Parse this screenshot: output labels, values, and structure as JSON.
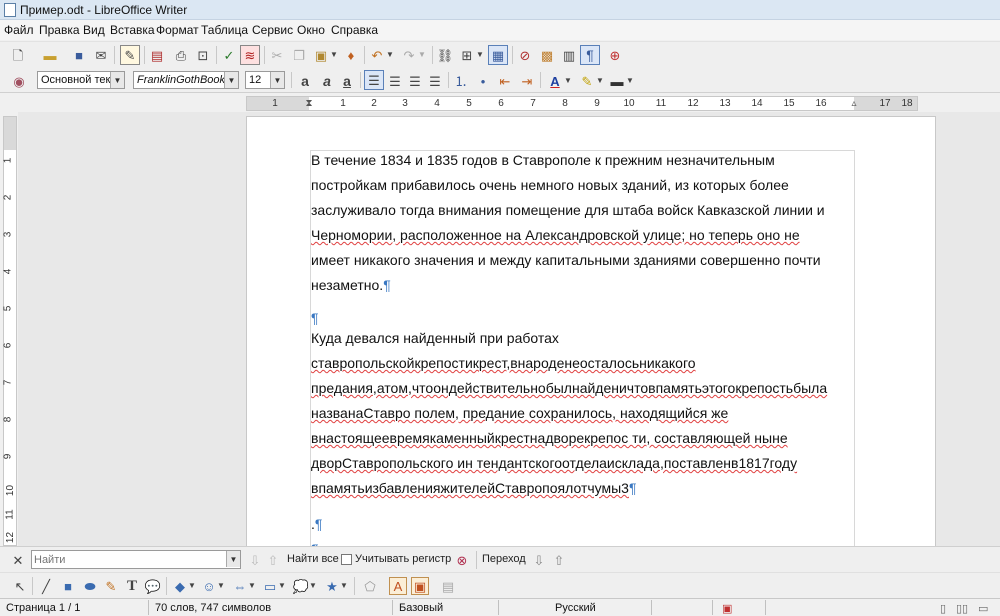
{
  "window": {
    "title": "Пример.odt - LibreOffice Writer"
  },
  "menu": [
    "Файл",
    "Правка",
    "Вид",
    "Вставка",
    "Формат",
    "Таблица",
    "Сервис",
    "Окно",
    "Справка"
  ],
  "formatting": {
    "paragraph_style": "Основной текс",
    "font_name": "FranklinGothBookTT",
    "font_size": "12"
  },
  "ruler": {
    "labels": [
      "1",
      "1",
      "2",
      "3",
      "4",
      "5",
      "6",
      "7",
      "8",
      "9",
      "10",
      "11",
      "12",
      "13",
      "14",
      "15",
      "16",
      "17",
      "18"
    ]
  },
  "vruler": {
    "labels": [
      "1",
      "2",
      "3",
      "4",
      "5",
      "6",
      "7",
      "8",
      "9",
      "10",
      "11",
      "12"
    ]
  },
  "document": {
    "para1_lines": [
      "В течение 1834 и 1835 годов в Ставрополе к прежним незначительным",
      "постройкам прибавилось очень немного новых зданий, из которых более",
      "заслуживало тогда внимания помещение для штаба войск Кавказской линии и",
      "Черномории, расположенное на Александровской улице; но теперь оно не",
      "имеет никакого значения и между капитальными зданиями совершенно почти",
      "незаметно."
    ],
    "pilcrow": "¶",
    "para2_lines": [
      "Куда девался найденный при работах",
      "ставропольскойкрепостикрест,внароденеосталосьникакого",
      "предания,атом,чтоондействительнобылнайденичтовпамятьэтогокрепостьбыла",
      "названаСтавро полем, предание сохранилось, находящийся же",
      "внастоящеевремякаменныйкрестнадворекрепос ти, составляющей ныне",
      "дворСтавропольского ин тендантскогоотделаисклада,поставленв1817году",
      "впамятьизбавленияжителейСтавропоялотчумы3"
    ],
    "para3": "."
  },
  "findbar": {
    "placeholder": "Найти",
    "find_all": "Найти все",
    "match_case": "Учитывать регистр",
    "navigate": "Переход"
  },
  "status": {
    "page": "Страница 1 / 1",
    "words": "70 слов, 747 символов",
    "style": "Базовый",
    "language": "Русский"
  }
}
